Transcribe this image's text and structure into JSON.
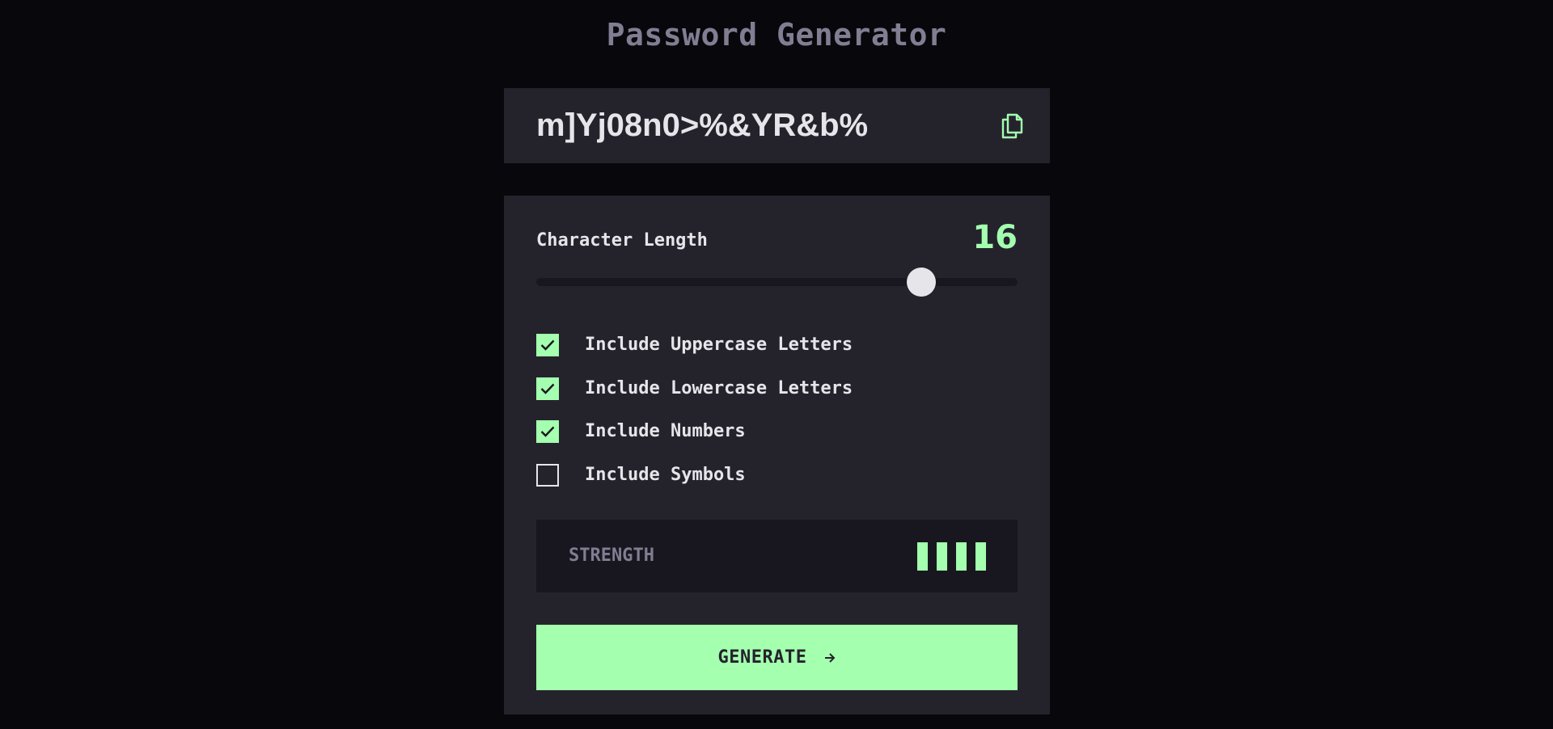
{
  "app": {
    "title": "Password Generator"
  },
  "output": {
    "password": "m]Yj08n0>%&YR&b%",
    "copy_icon": "copy-icon"
  },
  "settings": {
    "length_label": "Character Length",
    "length_value": "16",
    "slider": {
      "min": 0,
      "max": 20,
      "value": 16
    },
    "options": [
      {
        "label": "Include Uppercase Letters",
        "checked": true
      },
      {
        "label": "Include Lowercase Letters",
        "checked": true
      },
      {
        "label": "Include Numbers",
        "checked": true
      },
      {
        "label": "Include Symbols",
        "checked": false
      }
    ],
    "strength": {
      "label": "STRENGTH",
      "bars_filled": 4,
      "bars_total": 4
    },
    "generate_label": "GENERATE",
    "generate_icon": "arrow-right-icon"
  },
  "colors": {
    "background": "#08070b",
    "panel": "#24232c",
    "panel_dark": "#18171f",
    "accent": "#a4ffaf",
    "text": "#e6e5ea",
    "muted": "#817d92"
  }
}
